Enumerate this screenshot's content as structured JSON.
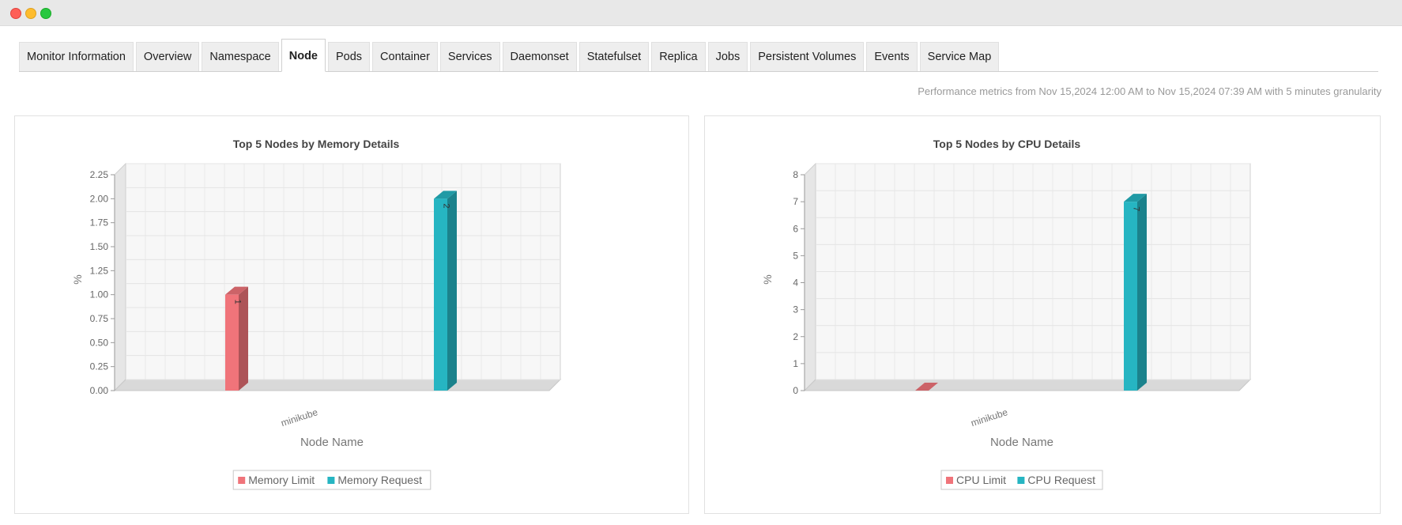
{
  "window": {
    "controls": [
      "close",
      "minimize",
      "maximize"
    ]
  },
  "tabs": [
    {
      "label": "Monitor Information",
      "active": false
    },
    {
      "label": "Overview",
      "active": false
    },
    {
      "label": "Namespace",
      "active": false
    },
    {
      "label": "Node",
      "active": true
    },
    {
      "label": "Pods",
      "active": false
    },
    {
      "label": "Container",
      "active": false
    },
    {
      "label": "Services",
      "active": false
    },
    {
      "label": "Daemonset",
      "active": false
    },
    {
      "label": "Statefulset",
      "active": false
    },
    {
      "label": "Replica",
      "active": false
    },
    {
      "label": "Jobs",
      "active": false
    },
    {
      "label": "Persistent Volumes",
      "active": false
    },
    {
      "label": "Events",
      "active": false
    },
    {
      "label": "Service Map",
      "active": false
    }
  ],
  "performance_text": "Performance metrics from Nov 15,2024 12:00 AM to Nov 15,2024 07:39 AM with 5 minutes granularity",
  "colors": {
    "limit": "#f0747a",
    "request": "#26b5c2"
  },
  "chart_data": [
    {
      "type": "bar",
      "title": "Top 5 Nodes by Memory Details",
      "xlabel": "Node Name",
      "ylabel": "%",
      "categories": [
        "minikube"
      ],
      "ylim": [
        0,
        2.25
      ],
      "yticks": [
        "0.00",
        "0.25",
        "0.50",
        "0.75",
        "1.00",
        "1.25",
        "1.50",
        "1.75",
        "2.00",
        "2.25"
      ],
      "grid": true,
      "legend_position": "bottom",
      "series": [
        {
          "name": "Memory Limit",
          "values": [
            1
          ],
          "label": "1"
        },
        {
          "name": "Memory Request",
          "values": [
            2
          ],
          "label": "2"
        }
      ]
    },
    {
      "type": "bar",
      "title": "Top 5 Nodes by CPU Details",
      "xlabel": "Node Name",
      "ylabel": "%",
      "categories": [
        "minikube"
      ],
      "ylim": [
        0,
        8
      ],
      "yticks": [
        "0",
        "1",
        "2",
        "3",
        "4",
        "5",
        "6",
        "7",
        "8"
      ],
      "grid": true,
      "legend_position": "bottom",
      "series": [
        {
          "name": "CPU Limit",
          "values": [
            0
          ],
          "label": ""
        },
        {
          "name": "CPU Request",
          "values": [
            7
          ],
          "label": "7"
        }
      ]
    }
  ]
}
